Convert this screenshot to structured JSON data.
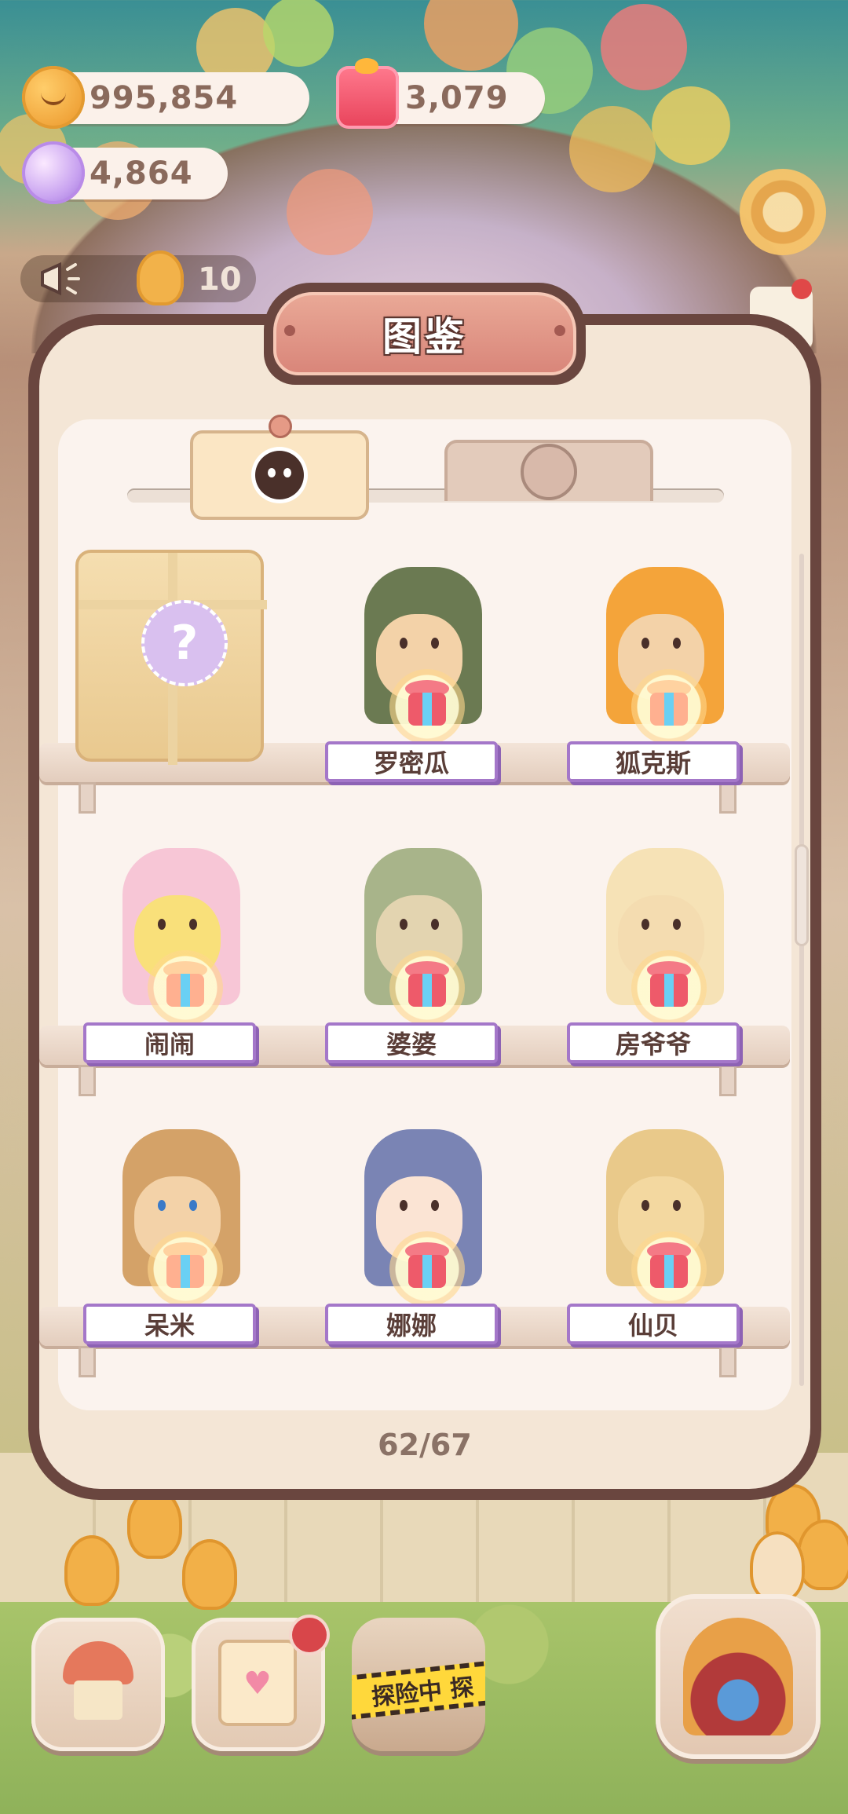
{
  "resources": {
    "cookies": "995,854",
    "jelly": "3,079",
    "crystals": "4,864"
  },
  "announcement": {
    "count": "10"
  },
  "panel": {
    "title": "图鉴",
    "counter": "62/67"
  },
  "tabs": [
    {
      "icon": "skull-icon",
      "active": true
    },
    {
      "icon": "face-icon",
      "active": false
    }
  ],
  "characters": [
    {
      "name": "罗密瓜",
      "gift": "red"
    },
    {
      "name": "狐克斯",
      "gift": "gold"
    },
    {
      "name": "闹闹",
      "gift": "gold"
    },
    {
      "name": "婆婆",
      "gift": "red"
    },
    {
      "name": "房爷爷",
      "gift": "red"
    },
    {
      "name": "呆米",
      "gift": "gold"
    },
    {
      "name": "娜娜",
      "gift": "red"
    },
    {
      "name": "仙贝",
      "gift": "red"
    }
  ],
  "nav": {
    "explore_label": "探险中 探"
  },
  "colors": {
    "panel_frame": "#6a463f",
    "paper": "#fbf3ee",
    "name_plate_border": "#a477c9",
    "title_plate": "#d9867a"
  }
}
